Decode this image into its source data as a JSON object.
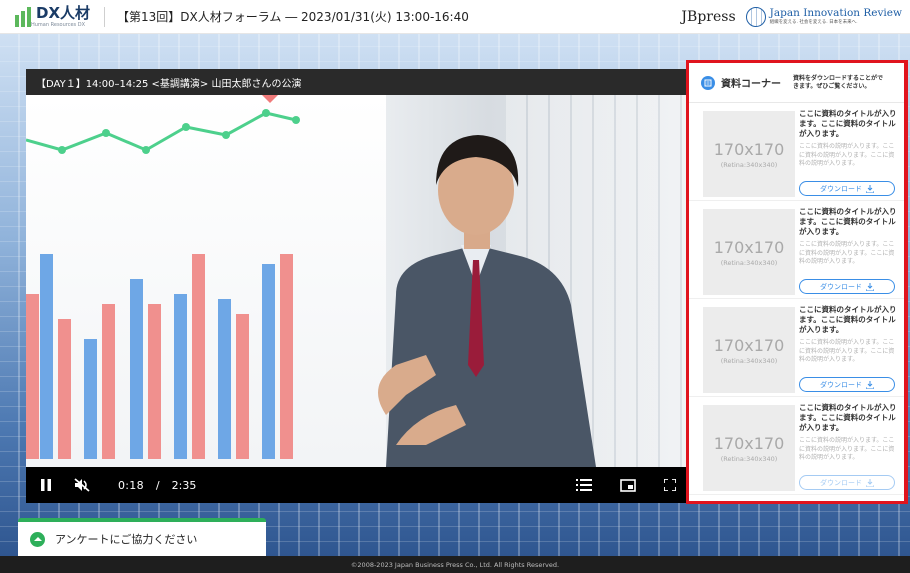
{
  "header": {
    "logo_text": "DX人材",
    "logo_sub": "Human Resources DX",
    "event_title": "【第13回】DX人材フォーラム ― 2023/01/31(火) 13:00-16:40",
    "jbpress": "JBpress",
    "jir_text": "Japan Innovation Review",
    "jir_sub": "組織を変える. 社会を変える. 日本を未来へ."
  },
  "player": {
    "session_title": "【DAY１】14:00–14:25 <基調講演> 山田太郎さんの公演",
    "current_time": "0:18",
    "separator": "/",
    "duration": "2:35",
    "state": "playing",
    "muted": true
  },
  "resources": {
    "title": "資料コーナー",
    "note": "資料をダウンロードすることができます。ぜひご覧ください。",
    "items": [
      {
        "thumb_size": "170x170",
        "thumb_retina": "(Retina:340x340)",
        "title": "ここに資料のタイトルが入ります。ここに資料のタイトルが入ります。",
        "description": "ここに資料の説明が入ります。ここに資料の説明が入ります。ここに資料の説明が入ります。",
        "download_label": "ダウンロード"
      },
      {
        "thumb_size": "170x170",
        "thumb_retina": "(Retina:340x340)",
        "title": "ここに資料のタイトルが入ります。ここに資料のタイトルが入ります。",
        "description": "ここに資料の説明が入ります。ここに資料の説明が入ります。ここに資料の説明が入ります。",
        "download_label": "ダウンロード"
      },
      {
        "thumb_size": "170x170",
        "thumb_retina": "(Retina:340x340)",
        "title": "ここに資料のタイトルが入ります。ここに資料のタイトルが入ります。",
        "description": "ここに資料の説明が入ります。ここに資料の説明が入ります。ここに資料の説明が入ります。",
        "download_label": "ダウンロード"
      },
      {
        "thumb_size": "170x170",
        "thumb_retina": "(Retina:340x340)",
        "title": "ここに資料のタイトルが入ります。ここに資料のタイトルが入ります。",
        "description": "ここに資料の説明が入ります。ここに資料の説明が入ります。ここに資料の説明が入ります。",
        "download_label": "ダウンロード"
      }
    ]
  },
  "survey": {
    "label": "アンケートにご協力ください"
  },
  "footer": {
    "copyright": "©2008-2023 Japan Business Press Co., Ltd. All Rights Reserved."
  },
  "icons": {
    "pause": "pause-icon",
    "mute": "volume-muted-icon",
    "chapters": "list-icon",
    "miniplayer": "miniplayer-icon",
    "fullscreen": "fullscreen-icon",
    "download": "download-icon",
    "resource": "document-icon",
    "survey": "chevron-up-icon"
  },
  "colors": {
    "brand_green": "#5cb85c",
    "highlight_red": "#e0141e",
    "accent_blue": "#3a8ee6",
    "survey_green": "#2eaf5a"
  }
}
